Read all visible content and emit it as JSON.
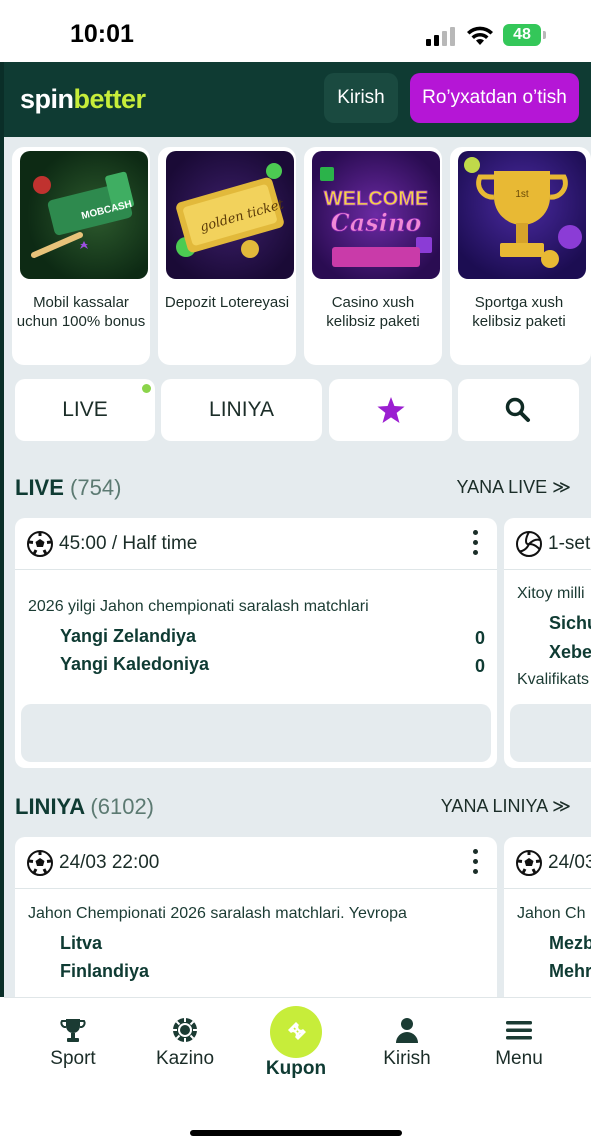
{
  "status_bar": {
    "time": "10:01",
    "battery": "48"
  },
  "header": {
    "logo_part1": "spin",
    "logo_part2": "better",
    "login_label": "Kirish",
    "register_label": "Ro’yxatdan o’tish"
  },
  "promos": [
    {
      "label": "Mobil kassalar uchun 100% bonus",
      "image_text": "MOBCASH"
    },
    {
      "label": "Depozit Lotereyasi",
      "image_text": "golden ticket"
    },
    {
      "label": "Casino xush kelibsiz paketi",
      "image_text_1": "WELCOME",
      "image_text_2": "Casino"
    },
    {
      "label": "Sportga xush kelibsiz paketi",
      "image_text": "1st"
    }
  ],
  "tabs": {
    "live": "LIVE",
    "liniya": "LINIYA"
  },
  "live_section": {
    "title": "LIVE",
    "count": "(754)",
    "more": "YANA LIVE ≫"
  },
  "live_cards": [
    {
      "time": "45:00 / Half time",
      "league": "2026 yilgi Jahon chempionati saralash matchlari",
      "team1": "Yangi Zelandiya",
      "score1": "0",
      "team2": "Yangi Kaledoniya",
      "score2": "0"
    },
    {
      "time": "1-set",
      "league": "Xitoy milli",
      "team1": "Sichu",
      "team2": "Xebe",
      "extra": "Kvalifikats"
    }
  ],
  "liniya_section": {
    "title": "LINIYA",
    "count": "(6102)",
    "more": "YANA LINIYA ≫"
  },
  "liniya_cards": [
    {
      "time": "24/03 22:00",
      "league": "Jahon Chempionati 2026 saralash matchlari. Yevropa",
      "team1": "Litva",
      "team2": "Finlandiya"
    },
    {
      "time": "24/03",
      "league": "Jahon Ch",
      "team1": "Mezb",
      "team2": "Mehr"
    }
  ],
  "bottom_nav": {
    "sport": "Sport",
    "kazino": "Kazino",
    "kupon": "Kupon",
    "kirish": "Kirish",
    "menu": "Menu"
  },
  "colors": {
    "header_bg": "#0f3b33",
    "accent_green": "#c7ed3a",
    "register_purple": "#b516d6",
    "star_purple": "#9b1fd1",
    "body_bg": "#e5ebee"
  }
}
